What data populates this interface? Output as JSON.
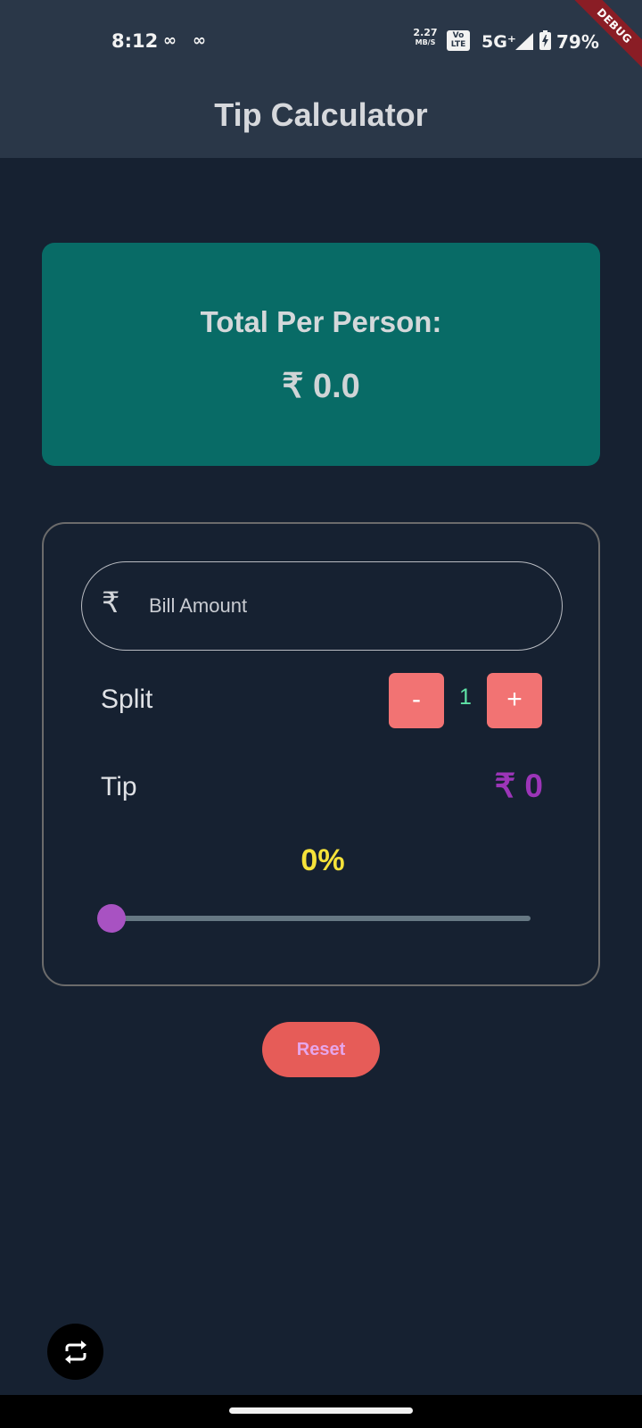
{
  "status_bar": {
    "time": "8:12",
    "notification_glyph": "∞",
    "net_speed_value": "2.27",
    "net_speed_unit": "MB/S",
    "volte_top": "Vo",
    "volte_bottom": "LTE",
    "network": "5G⁺",
    "battery": "79%",
    "debug_banner": "DEBUG"
  },
  "app_bar": {
    "title": "Tip Calculator"
  },
  "total_card": {
    "label": "Total Per Person:",
    "value": "₹ 0.0"
  },
  "bill": {
    "currency_icon": "rupee-icon",
    "currency_glyph": "₹",
    "placeholder": "Bill Amount",
    "value": ""
  },
  "split": {
    "label": "Split",
    "minus_label": "-",
    "plus_label": "+",
    "count": "1"
  },
  "tip": {
    "label": "Tip",
    "amount": "₹ 0",
    "percent_label": "0%",
    "slider_fraction": 0.0
  },
  "actions": {
    "reset_label": "Reset",
    "fab_icon": "repeat-icon"
  },
  "colors": {
    "background": "#162131",
    "app_bar": "#2a3748",
    "total_card": "#086b66",
    "stepper_button": "#f27373",
    "split_count": "#5fe3a6",
    "tip_amount": "#9c35b8",
    "tip_percent": "#f5e23a",
    "slider_thumb": "#a852c2",
    "reset_button": "#e65c58"
  }
}
